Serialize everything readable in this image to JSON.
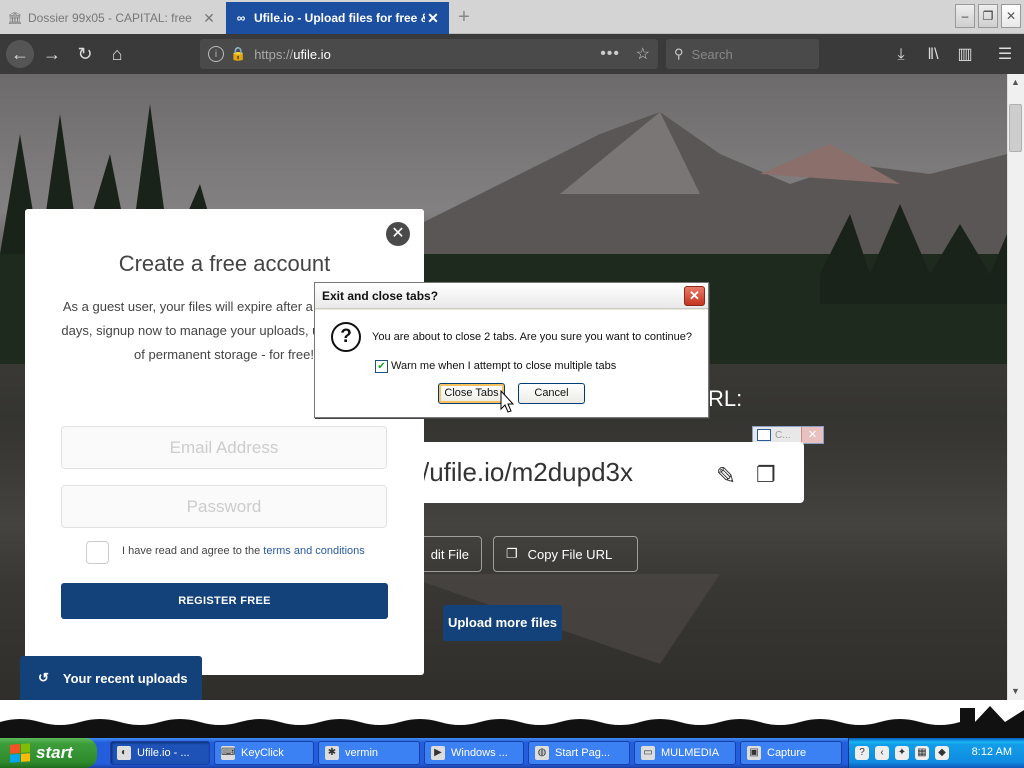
{
  "browser": {
    "tabs": [
      {
        "title": "Dossier 99x05 - CAPITAL: free",
        "active": false
      },
      {
        "title": "Ufile.io - Upload files for free & sh",
        "active": true
      }
    ],
    "url": {
      "protocol": "https://",
      "host": "ufile.io"
    },
    "search_placeholder": "Search",
    "icons": {
      "back": "back-arrow-icon",
      "forward": "forward-arrow-icon",
      "reload": "reload-icon",
      "home": "home-icon",
      "download": "download-icon",
      "library": "library-icon",
      "sidebar": "sidebar-icon",
      "menu": "hamburger-menu-icon"
    }
  },
  "signup": {
    "title": "Create a free account",
    "description": "As a guest user, your files will expire after a period of 30 days, signup now to manage your uploads, unlock 10GB of permanent storage - for free!",
    "email_placeholder": "Email Address",
    "password_placeholder": "Password",
    "terms_prefix": "I have read and agree to the",
    "terms_link": "terms and conditions",
    "register_label": "REGISTER FREE"
  },
  "page": {
    "url_heading": "RL:",
    "file_url": "/ufile.io/m2dupd3x",
    "edit_file_label": "dit File",
    "copy_url_label": "Copy File URL",
    "upload_more_label": "Upload more files",
    "recent_uploads_label": "Your recent uploads",
    "mini_window_label": "C..."
  },
  "dialog": {
    "title": "Exit and close tabs?",
    "message": "You are about to close 2 tabs. Are you sure you want to continue?",
    "checkbox_label": "Warn me when I attempt to close multiple tabs",
    "checkbox_checked": true,
    "primary_button": "Close Tabs",
    "cancel_button": "Cancel"
  },
  "taskbar": {
    "start_label": "start",
    "tasks": [
      {
        "label": "Ufile.io - ...",
        "pressed": true
      },
      {
        "label": "KeyClick",
        "pressed": false
      },
      {
        "label": "vermin",
        "pressed": false
      },
      {
        "label": "Windows ...",
        "pressed": false
      },
      {
        "label": "Start Pag...",
        "pressed": false
      },
      {
        "label": "MULMEDIA",
        "pressed": false
      },
      {
        "label": "Capture",
        "pressed": false
      }
    ],
    "clock": "8:12 AM"
  },
  "colors": {
    "brand_blue": "#13427b",
    "tab_active": "#1c4fa0",
    "xp_taskbar": "#245edc",
    "xp_start": "#3c9d3a"
  }
}
